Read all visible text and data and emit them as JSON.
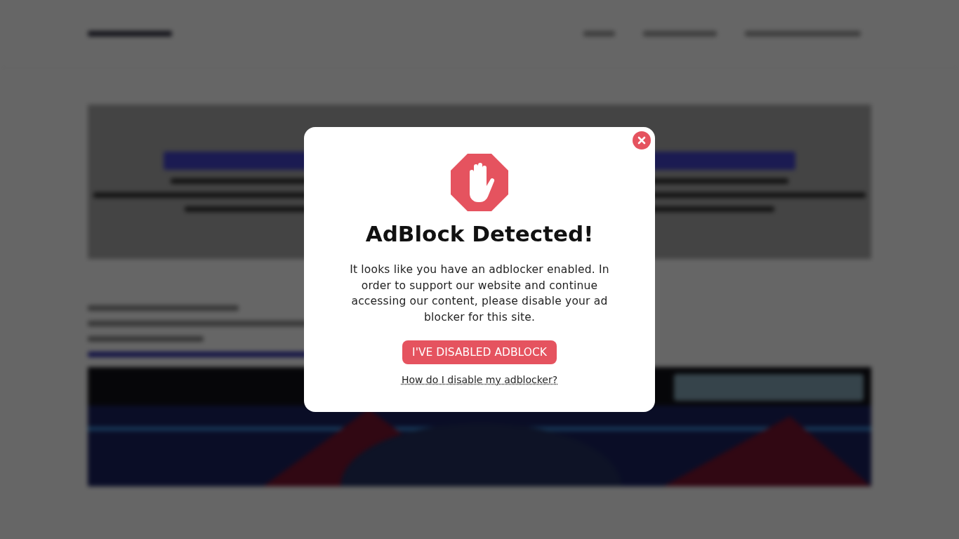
{
  "modal": {
    "title": "AdBlock Detected!",
    "message": "It looks like you have an adblocker enabled. In order to support our website and continue accessing our content, please disable your ad blocker for this site.",
    "button": "I'VE DISABLED ADBLOCK",
    "link": "How do I disable my adblocker?"
  }
}
